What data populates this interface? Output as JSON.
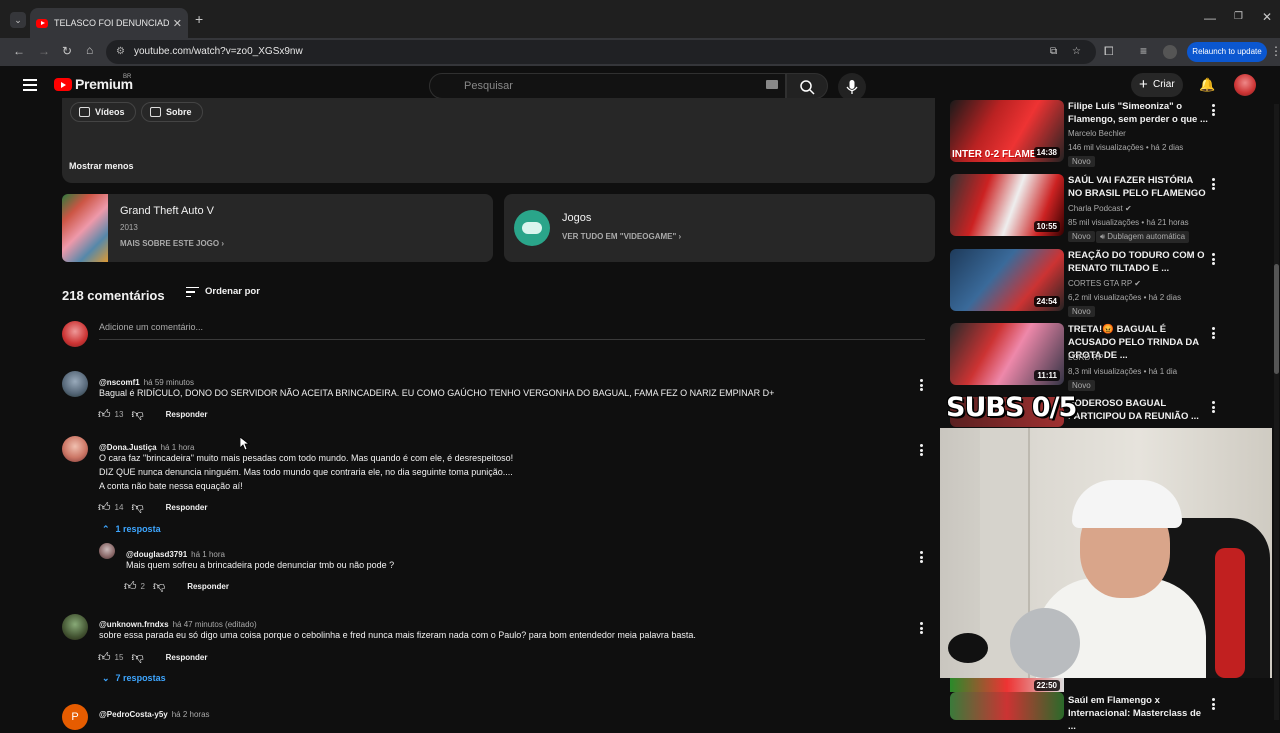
{
  "browser": {
    "tab_title": "TELASCO FOI DENUNCIADO PO",
    "url": "youtube.com/watch?v=zo0_XGSx9nw",
    "relaunch_label": "Relaunch to update"
  },
  "header": {
    "logo": "Premium",
    "logo_badge": "BR",
    "search_placeholder": "Pesquisar",
    "create_label": "Criar"
  },
  "channel_tabs": {
    "videos": "Vídeos",
    "about": "Sobre"
  },
  "show_less": "Mostrar menos",
  "game_card": {
    "title": "Grand Theft Auto V",
    "year": "2013",
    "link": "MAIS SOBRE ESTE JOGO"
  },
  "category_card": {
    "title": "Jogos",
    "link": "VER TUDO EM \"VIDEOGAME\""
  },
  "comments": {
    "count": "218 comentários",
    "sort_label": "Ordenar por",
    "add_placeholder": "Adicione um comentário...",
    "reply_label": "Responder",
    "items": [
      {
        "author": "@nscomf1",
        "time": "há 59 minutos",
        "lines": [
          "Bagual é RIDÍCULO, DONO DO SERVIDOR NÃO ACEITA BRINCADEIRA. EU COMO GAÚCHO TENHO VERGONHA DO BAGUAL, FAMA FEZ O NARIZ EMPINAR D+"
        ],
        "likes": "13"
      },
      {
        "author": "@Dona.Justiça",
        "time": "há 1 hora",
        "lines": [
          "O cara faz \"brincadeira\" muito mais pesadas com todo mundo. Mas quando é com ele, é desrespeitoso!",
          "DIZ QUE nunca denuncia ninguém. Mas todo mundo que contraria ele, no dia seguinte toma punição....",
          "A conta não bate nessa equação aí!"
        ],
        "likes": "14",
        "replies_toggle": "1 resposta"
      },
      {
        "author": "@douglasd3791",
        "time": "há 1 hora",
        "lines": [
          "Mais quem sofreu a brincadeira pode denunciar tmb ou não pode ?"
        ],
        "likes": "2"
      },
      {
        "author": "@unknown.frndxs",
        "time": "há 47 minutos (editado)",
        "lines": [
          "sobre essa parada eu só digo uma coisa porque o cebolinha e fred nunca mais fizeram nada com o Paulo? para bom entendedor meia palavra basta."
        ],
        "likes": "15",
        "replies_toggle": "7 respostas"
      },
      {
        "author": "@PedroCosta-y5y",
        "time": "há 2 horas",
        "avatar_letter": "P"
      }
    ]
  },
  "sidebar": {
    "videos": [
      {
        "title": "Filipe Luís \"Simeoniza\" o Flamengo, sem perder o que ...",
        "channel": "Marcelo Bechler",
        "meta": "146 mil visualizações • há 2 dias",
        "badges": [
          "Novo"
        ],
        "duration": "14:38",
        "thumb_text": "INTER 0-2 FLAME"
      },
      {
        "title": "SAÚL VAI FAZER HISTÓRIA NO BRASIL PELO FLAMENGO",
        "channel": "Charla Podcast",
        "meta": "85 mil visualizações • há 21 horas",
        "badges": [
          "Novo",
          "Dublagem automática"
        ],
        "duration": "10:55"
      },
      {
        "title": "REAÇÃO DO TODURO COM O RENATO TILTADO E ...",
        "channel": "CORTES GTA RP",
        "meta": "6,2 mil visualizações • há 2 dias",
        "badges": [
          "Novo"
        ],
        "duration": "24:54"
      },
      {
        "title": "TRETA!😡 BAGUAL É ACUSADO PELO TRINDA DA GROTA DE ...",
        "channel": "LORD RP",
        "meta": "8,3 mil visualizações • há 1 dia",
        "badges": [
          "Novo"
        ],
        "duration": "11:11"
      },
      {
        "title": "PODEROSO BAGUAL PARTICIPOU DA REUNIÃO ...",
        "overlay_text": "SUBS 0/5"
      },
      {
        "title": "Saúl em Flamengo x Internacional: Masterclass de ...",
        "duration": "22:50"
      }
    ]
  }
}
